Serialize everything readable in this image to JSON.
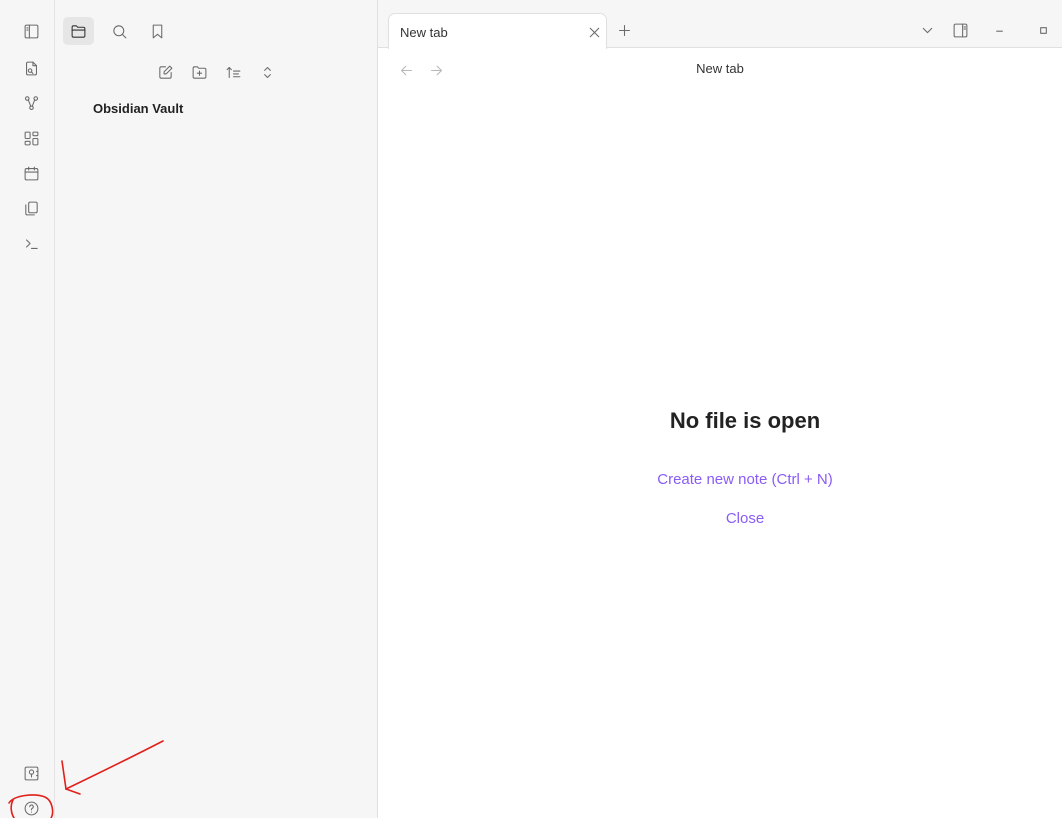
{
  "tab": {
    "title": "New tab"
  },
  "nav": {
    "title": "New tab"
  },
  "sidebar": {
    "vault_name": "Obsidian Vault"
  },
  "empty_state": {
    "title": "No file is open",
    "create_link": "Create new note (Ctrl + N)",
    "close_link": "Close"
  },
  "colors": {
    "accent": "#8a5cf5",
    "annotation": "#e0201b",
    "sidebar_bg": "#f6f6f6"
  },
  "icons": {
    "ribbon": [
      "open-quick-switcher-icon",
      "graph-view-icon",
      "canvas-icon",
      "daily-note-icon",
      "templates-icon",
      "command-palette-icon"
    ],
    "ribbon_bottom": [
      "vault-switcher-icon",
      "help-icon"
    ],
    "sidebar_tabs": [
      "file-explorer-icon",
      "search-icon",
      "bookmarks-icon"
    ],
    "file_actions": [
      "new-note-icon",
      "new-folder-icon",
      "sort-order-icon",
      "collapse-all-icon"
    ],
    "window": [
      "tab-list-chevron-icon",
      "toggle-right-sidebar-icon",
      "minimize-icon",
      "maximize-icon"
    ]
  }
}
